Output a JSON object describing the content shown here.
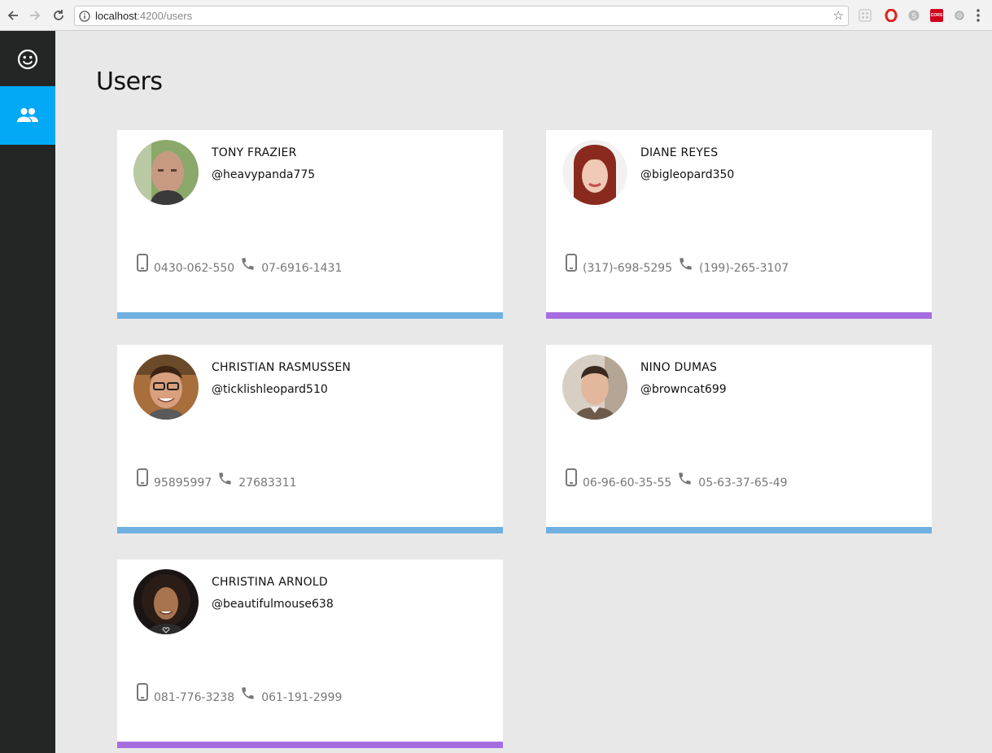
{
  "browser": {
    "url_host": "localhost",
    "url_path": ":4200/users",
    "star_icon": "star-icon",
    "extensions": [
      {
        "name": "extension-grid-icon"
      },
      {
        "name": "opera-icon"
      },
      {
        "name": "skype-icon"
      },
      {
        "name": "cors-icon",
        "label": "CORS"
      },
      {
        "name": "circle-extension-icon"
      }
    ]
  },
  "sidebar": {
    "items": [
      {
        "icon": "smiley-icon",
        "active": false
      },
      {
        "icon": "people-icon",
        "active": true
      }
    ],
    "active_color": "#03a9f4"
  },
  "page": {
    "title": "Users"
  },
  "users": [
    {
      "name": "TONY FRAZIER",
      "handle": "@heavypanda775",
      "mobile": "0430-062-550",
      "phone": "07-6916-1431",
      "bar_color": "#6fb0e0"
    },
    {
      "name": "DIANE REYES",
      "handle": "@bigleopard350",
      "mobile": "(317)-698-5295",
      "phone": "(199)-265-3107",
      "bar_color": "#a56ee0"
    },
    {
      "name": "CHRISTIAN RASMUSSEN",
      "handle": "@ticklishleopard510",
      "mobile": "95895997",
      "phone": "27683311",
      "bar_color": "#6fb0e0"
    },
    {
      "name": "NINO DUMAS",
      "handle": "@browncat699",
      "mobile": "06-96-60-35-55",
      "phone": "05-63-37-65-49",
      "bar_color": "#6fb0e0"
    },
    {
      "name": "CHRISTINA ARNOLD",
      "handle": "@beautifulmouse638",
      "mobile": "081-776-3238",
      "phone": "061-191-2999",
      "bar_color": "#a56ee0"
    }
  ]
}
